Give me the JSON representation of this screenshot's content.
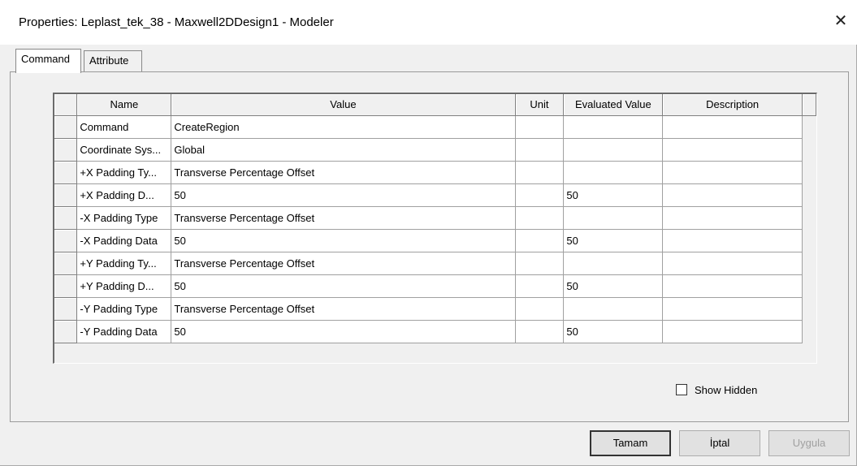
{
  "window": {
    "title": "Properties: Leplast_tek_38 - Maxwell2DDesign1 - Modeler",
    "close_glyph": "✕"
  },
  "tabs": [
    {
      "label": "Command",
      "active": true
    },
    {
      "label": "Attribute",
      "active": false
    }
  ],
  "grid": {
    "columns": [
      "Name",
      "Value",
      "Unit",
      "Evaluated Value",
      "Description"
    ],
    "rows": [
      {
        "name": "Command",
        "value": "CreateRegion",
        "unit": "",
        "evaluated": "",
        "description": ""
      },
      {
        "name": "Coordinate Sys...",
        "value": "Global",
        "unit": "",
        "evaluated": "",
        "description": ""
      },
      {
        "name": "+X Padding Ty...",
        "value": "Transverse Percentage Offset",
        "unit": "",
        "evaluated": "",
        "description": ""
      },
      {
        "name": "+X Padding D...",
        "value": "50",
        "unit": "",
        "evaluated": "50",
        "description": ""
      },
      {
        "name": "-X Padding Type",
        "value": "Transverse Percentage Offset",
        "unit": "",
        "evaluated": "",
        "description": ""
      },
      {
        "name": "-X Padding Data",
        "value": "50",
        "unit": "",
        "evaluated": "50",
        "description": ""
      },
      {
        "name": "+Y Padding Ty...",
        "value": "Transverse Percentage Offset",
        "unit": "",
        "evaluated": "",
        "description": ""
      },
      {
        "name": "+Y Padding D...",
        "value": "50",
        "unit": "",
        "evaluated": "50",
        "description": ""
      },
      {
        "name": "-Y Padding Type",
        "value": "Transverse Percentage Offset",
        "unit": "",
        "evaluated": "",
        "description": ""
      },
      {
        "name": "-Y Padding Data",
        "value": "50",
        "unit": "",
        "evaluated": "50",
        "description": ""
      }
    ]
  },
  "show_hidden": {
    "label": "Show Hidden",
    "checked": false
  },
  "buttons": {
    "ok": "Tamam",
    "cancel": "İptal",
    "apply": "Uygula"
  }
}
